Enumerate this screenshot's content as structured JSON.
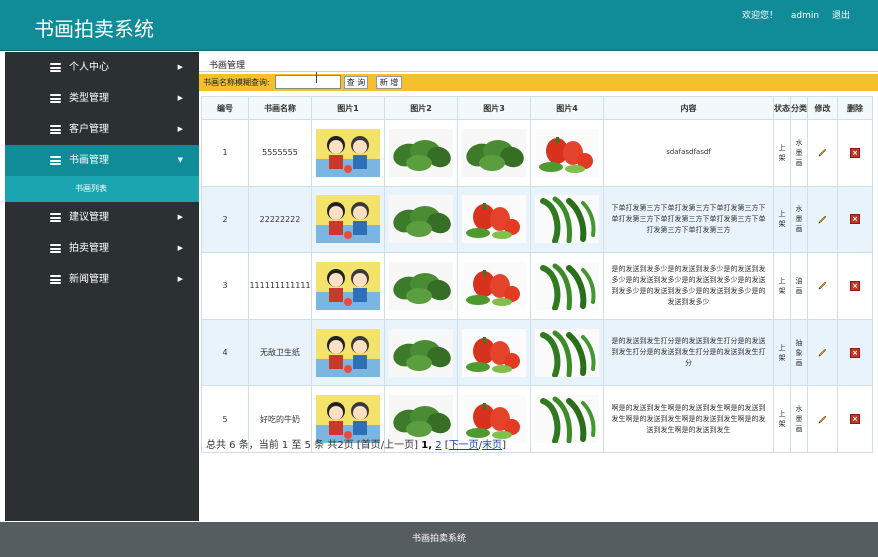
{
  "header": {
    "title": "书画拍卖系统",
    "welcome": "欢迎您！",
    "user": "admin",
    "logout": "退出"
  },
  "sidebar": {
    "items": [
      {
        "label": "个人中心",
        "arrow": "▶"
      },
      {
        "label": "类型管理",
        "arrow": "▶"
      },
      {
        "label": "客户管理",
        "arrow": "▶"
      },
      {
        "label": "书画管理",
        "arrow": "▼"
      },
      {
        "label": "建议管理",
        "arrow": "▶"
      },
      {
        "label": "拍卖管理",
        "arrow": "▶"
      },
      {
        "label": "新闻管理",
        "arrow": "▶"
      }
    ],
    "subitem": "书画列表"
  },
  "main": {
    "title": "书画管理",
    "search": {
      "label": "书画名称模糊查询:",
      "value": "",
      "query_button": "查 询",
      "add_button": "新 增"
    },
    "table": {
      "headers": [
        "编号",
        "书画名称",
        "图片1",
        "图片2",
        "图片3",
        "图片4",
        "内容",
        "状态",
        "分类",
        "修改",
        "删除"
      ],
      "rows": [
        {
          "id": "1",
          "name": "5555555",
          "images": [
            "cartoon-boys",
            "spinach",
            "spinach",
            "vegetables"
          ],
          "content": "sdafasdfasdf",
          "status": "上架",
          "category": "水墨画"
        },
        {
          "id": "2",
          "name": "22222222",
          "images": [
            "cartoon-boys",
            "spinach",
            "vegetables",
            "green-peppers"
          ],
          "content": "下单打发第三方下单打发第三方下单打发第三方下单打发第三方下单打发第三方下单打发第三方下单打发第三方下单打发第三方",
          "status": "上架",
          "category": "水墨画"
        },
        {
          "id": "3",
          "name": "111111111111",
          "images": [
            "cartoon-boys",
            "spinach",
            "vegetables",
            "green-peppers"
          ],
          "content": "是的发送到发多少是的发送到发多少是的发送到发多少是的发送到发多少是的发送到发多少是的发送到发多少是的发送到发多少是的发送到发多少是的发送到发多少",
          "status": "上架",
          "category": "油画"
        },
        {
          "id": "4",
          "name": "无敌卫生纸",
          "images": [
            "cartoon-boys",
            "spinach",
            "vegetables",
            "green-peppers"
          ],
          "content": "是的发送到发生打分是的发送到发生打分是的发送到发生打分是的发送到发生打分是的发送到发生打分",
          "status": "上架",
          "category": "抽象画"
        },
        {
          "id": "5",
          "name": "好吃的牛奶",
          "images": [
            "cartoon-boys",
            "spinach",
            "vegetables",
            "green-peppers"
          ],
          "content": "啊是的发送到发生啊是的发送到发生啊是的发送到发生啊是的发送到发生啊是的发送到发生啊是的发送到发生啊是的发送到发生",
          "status": "上架",
          "category": "水墨画"
        }
      ],
      "edit_icon": "pencil-icon",
      "delete_icon": "delete-x-icon"
    },
    "pager": {
      "summary": "总共 6 条，当前 1 至 5 条 共2页",
      "first_prev": "[首页/上一页]",
      "page1": "1",
      "page2": "2",
      "next": "下一页",
      "last": "末页"
    }
  },
  "footer": {
    "text": "书画拍卖系统"
  },
  "colors": {
    "teal": "#0f8c97",
    "sidebar": "#2b3033",
    "search_bar": "#f5c02c",
    "footer": "#555d60"
  }
}
